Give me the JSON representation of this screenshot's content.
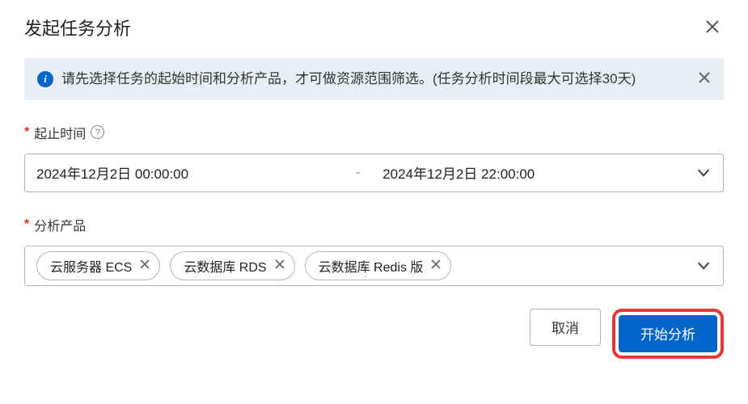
{
  "dialog": {
    "title": "发起任务分析",
    "banner": {
      "text": "请先选择任务的起始时间和分析产品，才可做资源范围筛选。(任务分析时间段最大可选择30天)"
    },
    "timeRange": {
      "label": "起止时间",
      "start": "2024年12月2日 00:00:00",
      "separator": "-",
      "end": "2024年12月2日 22:00:00"
    },
    "products": {
      "label": "分析产品",
      "selected": [
        "云服务器 ECS",
        "云数据库 RDS",
        "云数据库 Redis 版"
      ]
    },
    "footer": {
      "cancel": "取消",
      "submit": "开始分析"
    }
  }
}
